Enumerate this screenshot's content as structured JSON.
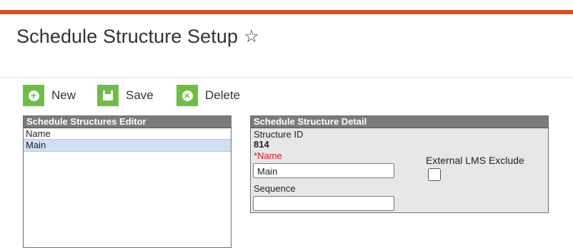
{
  "page": {
    "title": "Schedule Structure Setup",
    "favorite_icon": "star-outline-icon"
  },
  "toolbar": {
    "new_label": "New",
    "save_label": "Save",
    "delete_label": "Delete",
    "accent_color": "#6ebd45"
  },
  "editor": {
    "title": "Schedule Structures Editor",
    "column_header": "Name",
    "rows": [
      {
        "name": "Main",
        "selected": true
      }
    ]
  },
  "detail": {
    "title": "Schedule Structure Detail",
    "structure_id_label": "Structure ID",
    "structure_id_value": "814",
    "name_required_marker": "*",
    "name_label": "Name",
    "name_value": "Main",
    "sequence_label": "Sequence",
    "sequence_value": "",
    "external_lms_label": "External LMS Exclude",
    "external_lms_checked": false
  },
  "colors": {
    "top_accent": "#d2532e",
    "panel_header": "#7b7b7b",
    "selected_row": "#cfe0f2",
    "required": "#e0131a"
  }
}
